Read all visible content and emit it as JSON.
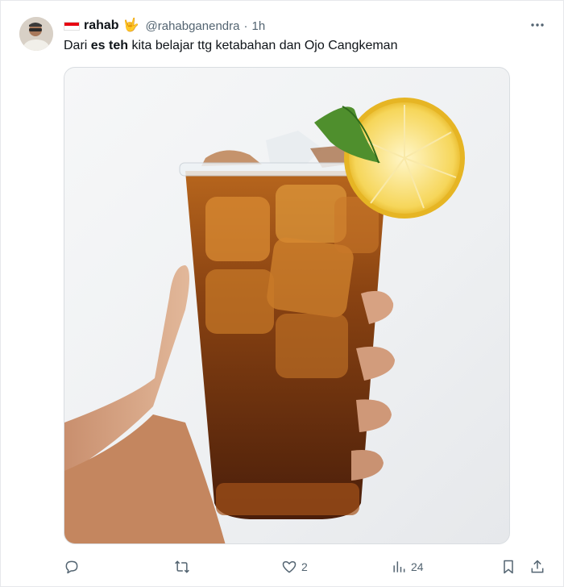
{
  "tweet": {
    "author_name": "rahab",
    "author_flag_icon": "indonesia-flag-icon",
    "author_emoji": "🤟",
    "handle": "@rahabganendra",
    "separator": "·",
    "time": "1h",
    "more_icon": "ellipsis-icon",
    "text_before": "Dari ",
    "text_bold": "es teh",
    "text_after": " kita belajar ttg ketabahan dan Ojo Cangkeman",
    "image": "photo of a hand holding a plastic cup of iced tea with lemon slice and mint"
  },
  "actions": {
    "reply_icon": "reply-icon",
    "retweet_icon": "retweet-icon",
    "like_icon": "heart-icon",
    "like_count": "2",
    "views_icon": "views-icon",
    "views_count": "24",
    "bookmark_icon": "bookmark-icon",
    "share_icon": "share-icon"
  },
  "colors": {
    "text": "#0f1419",
    "secondary": "#536471",
    "tea": "#7a3d12",
    "lemon": "#f7d85a"
  }
}
